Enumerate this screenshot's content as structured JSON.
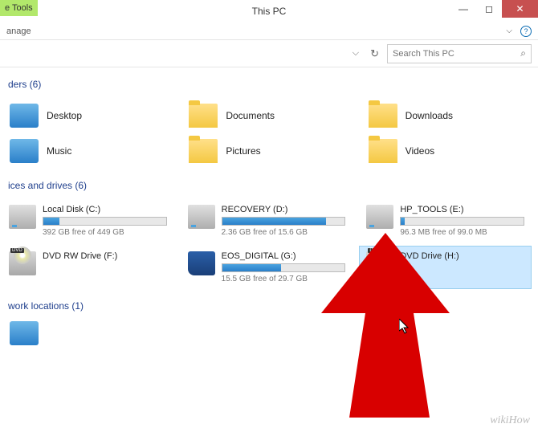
{
  "titlebar": {
    "tools_label": "e Tools",
    "title": "This PC"
  },
  "menubar": {
    "item": "anage"
  },
  "search": {
    "placeholder": "Search This PC"
  },
  "sections": {
    "folders": "ders (6)",
    "drives": "ices and drives (6)",
    "network": "work locations (1)"
  },
  "folders": [
    {
      "label": "Desktop"
    },
    {
      "label": "Documents"
    },
    {
      "label": "Downloads"
    },
    {
      "label": "Music"
    },
    {
      "label": "Pictures"
    },
    {
      "label": "Videos"
    }
  ],
  "drives": [
    {
      "name": "Local Disk (C:)",
      "info": "392 GB free of 449 GB",
      "fill": 13
    },
    {
      "name": "RECOVERY (D:)",
      "info": "2.36 GB free of 15.6 GB",
      "fill": 85
    },
    {
      "name": "HP_TOOLS (E:)",
      "info": "96.3 MB free of 99.0 MB",
      "fill": 3
    },
    {
      "name": "DVD RW Drive (F:)",
      "info": "",
      "fill": null
    },
    {
      "name": "EOS_DIGITAL (G:)",
      "info": "15.5 GB free of 29.7 GB",
      "fill": 48
    },
    {
      "name": "DVD Drive (H:)",
      "info": "",
      "fill": null
    }
  ],
  "watermark": "wikiHow"
}
